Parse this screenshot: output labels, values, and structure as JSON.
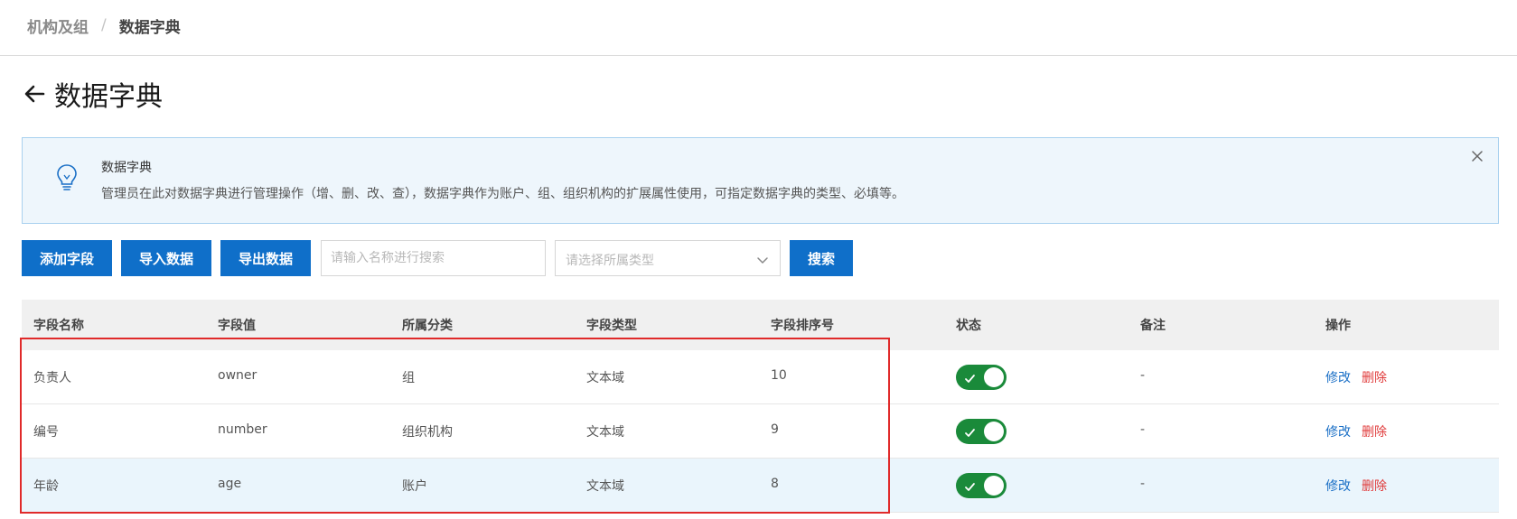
{
  "breadcrumb": {
    "parent": "机构及组",
    "separator": "/",
    "current": "数据字典"
  },
  "page": {
    "title": "数据字典"
  },
  "notice": {
    "title": "数据字典",
    "description": "管理员在此对数据字典进行管理操作（增、删、改、查），数据字典作为账户、组、组织机构的扩展属性使用，可指定数据字典的类型、必填等。"
  },
  "toolbar": {
    "add_label": "添加字段",
    "import_label": "导入数据",
    "export_label": "导出数据",
    "search_placeholder": "请输入名称进行搜索",
    "type_placeholder": "请选择所属类型",
    "search_label": "搜索"
  },
  "table": {
    "headers": [
      "字段名称",
      "字段值",
      "所属分类",
      "字段类型",
      "字段排序号",
      "状态",
      "备注",
      "操作"
    ],
    "rows": [
      {
        "name": "负责人",
        "value": "owner",
        "category": "组",
        "type": "文本域",
        "order": "10",
        "status": true,
        "remark": "-",
        "edit": "修改",
        "delete": "删除"
      },
      {
        "name": "编号",
        "value": "number",
        "category": "组织机构",
        "type": "文本域",
        "order": "9",
        "status": true,
        "remark": "-",
        "edit": "修改",
        "delete": "删除"
      },
      {
        "name": "年龄",
        "value": "age",
        "category": "账户",
        "type": "文本域",
        "order": "8",
        "status": true,
        "remark": "-",
        "edit": "修改",
        "delete": "删除"
      }
    ]
  },
  "colors": {
    "primary": "#0f6fc9",
    "switch_on": "#1a8a3a",
    "danger": "#e03a3a",
    "highlight": "#e02a2a"
  }
}
